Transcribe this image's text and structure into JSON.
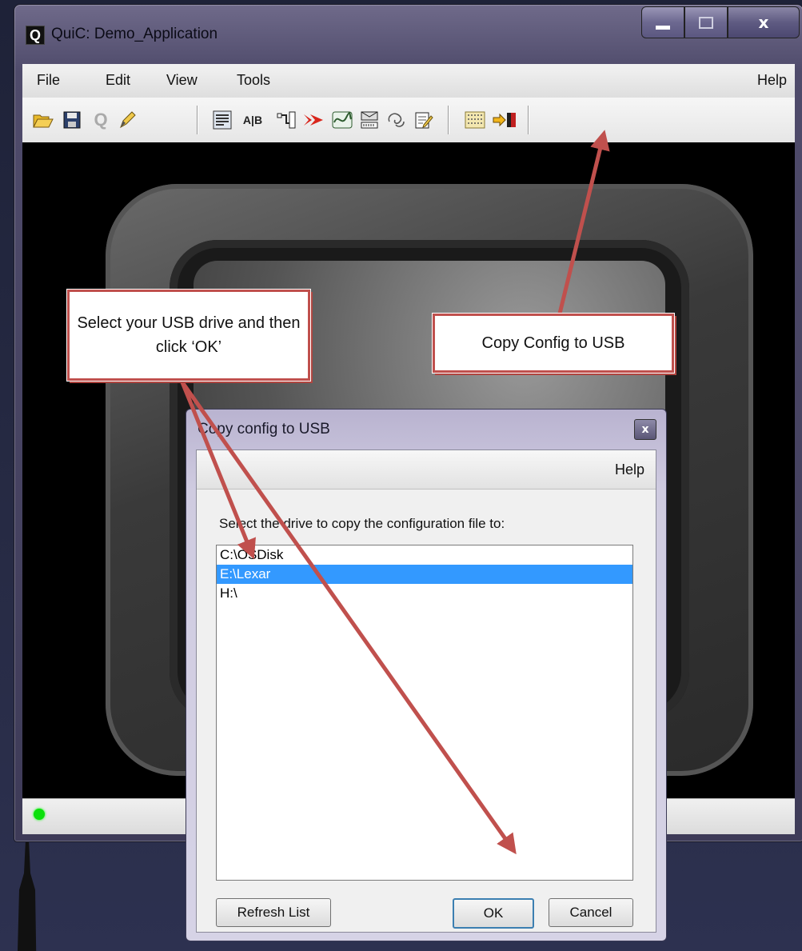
{
  "window": {
    "title": "QuiC: Demo_Application",
    "logo_letter": "Q",
    "caption": {
      "minimize": "",
      "maximize": "",
      "close": "x"
    }
  },
  "menubar": {
    "file": "File",
    "edit": "Edit",
    "view": "View",
    "tools": "Tools",
    "help": "Help"
  },
  "toolbar_icons": [
    "open-folder-icon",
    "save-icon",
    "q-icon",
    "pencil-icon",
    "grid-form-icon",
    "a-b-icon",
    "flow-icon",
    "arrow-red-icon",
    "wave-icon",
    "device-icon",
    "loop-icon",
    "note-edit-icon",
    "dotted-grid-icon",
    "copy-config-to-usb-icon"
  ],
  "status": {
    "led_color": "#0be00b"
  },
  "dialog": {
    "title": "Copy config to USB",
    "close": "x",
    "menu_help": "Help",
    "prompt": "Select the drive to copy the configuration file to:",
    "drives": [
      "C:\\OSDisk",
      "E:\\Lexar",
      "H:\\"
    ],
    "selected_drive": "E:\\Lexar",
    "refresh_button": "Refresh List",
    "ok_button": "OK",
    "cancel_button": "Cancel"
  },
  "annotations": {
    "callout_select": "Select your USB drive and then click ‘OK’",
    "callout_copy": "Copy Config to USB",
    "arrow_color": "#c0504d"
  }
}
